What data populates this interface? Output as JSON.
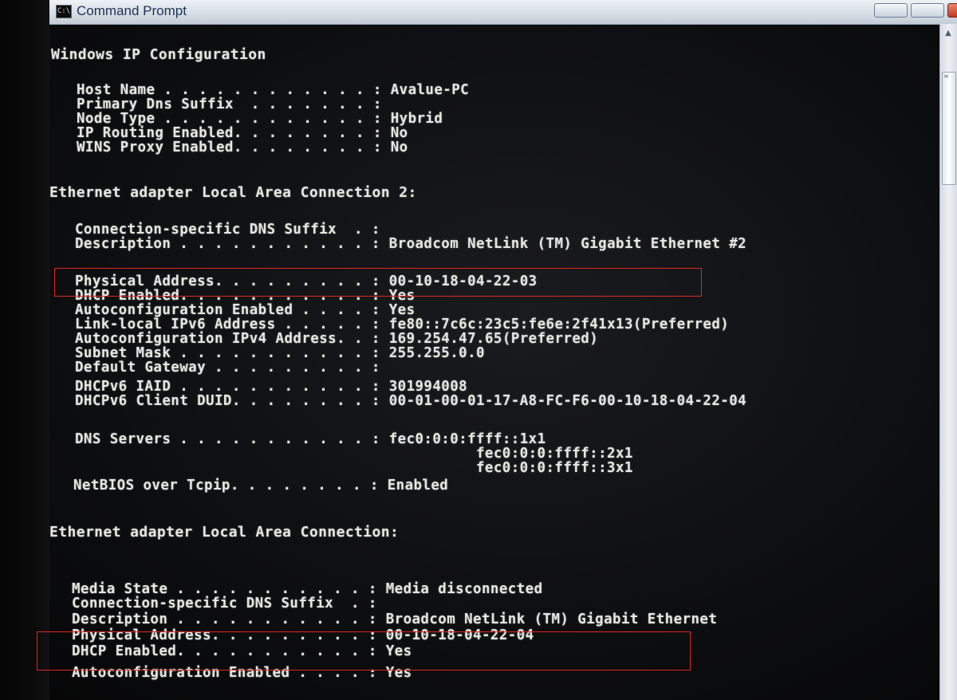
{
  "window": {
    "title": "Command Prompt",
    "icon": "cmd-icon",
    "colors": {
      "console_bg": "#0d0e10",
      "console_text": "#e6e6e2",
      "titlebar": "#d7dee6",
      "highlight_box": "#e0271e",
      "close_button": "#c23a22"
    }
  },
  "console": {
    "section_windows": "Windows IP Configuration",
    "host_name": "Host Name . . . . . . . . . . . . : Avalue-PC",
    "primary_dns_suffix": "Primary Dns Suffix  . . . . . . . :",
    "node_type": "Node Type . . . . . . . . . . . . : Hybrid",
    "ip_routing": "IP Routing Enabled. . . . . . . . : No",
    "wins_proxy": "WINS Proxy Enabled. . . . . . . . : No",
    "section_lac2": "Ethernet adapter Local Area Connection 2:",
    "lac2_dns_suffix": "Connection-specific DNS Suffix  . :",
    "lac2_description": "Description . . . . . . . . . . . : Broadcom NetLink (TM) Gigabit Ethernet #2",
    "lac2_physical": "Physical Address. . . . . . . . . : 00-10-18-04-22-03",
    "lac2_dhcp": "DHCP Enabled. . . . . . . . . . . : Yes",
    "lac2_autoconf": "Autoconfiguration Enabled . . . . : Yes",
    "lac2_ipv6": "Link-local IPv6 Address . . . . . : fe80::7c6c:23c5:fe6e:2f41x13(Preferred)",
    "lac2_ipv4": "Autoconfiguration IPv4 Address. . : 169.254.47.65(Preferred)",
    "lac2_subnet": "Subnet Mask . . . . . . . . . . . : 255.255.0.0",
    "lac2_gateway": "Default Gateway . . . . . . . . . :",
    "lac2_iaid": "DHCPv6 IAID . . . . . . . . . . . : 301994008",
    "lac2_duid": "DHCPv6 Client DUID. . . . . . . . : 00-01-00-01-17-A8-FC-F6-00-10-18-04-22-04",
    "lac2_dns1": "DNS Servers . . . . . . . . . . . : fec0:0:0:ffff::1x1",
    "lac2_dns2": "fec0:0:0:ffff::2x1",
    "lac2_dns3": "fec0:0:0:ffff::3x1",
    "lac2_netbios": "NetBIOS over Tcpip. . . . . . . . : Enabled",
    "section_lac": "Ethernet adapter Local Area Connection:",
    "lac_media": "Media State . . . . . . . . . . . : Media disconnected",
    "lac_dns_suffix": "Connection-specific DNS Suffix  . :",
    "lac_description": "Description . . . . . . . . . . . : Broadcom NetLink (TM) Gigabit Ethernet",
    "lac_physical": "Physical Address. . . . . . . . . : 00-10-18-04-22-04",
    "lac_dhcp": "DHCP Enabled. . . . . . . . . . . : Yes",
    "lac_autoconf": "Autoconfiguration Enabled . . . . : Yes"
  }
}
